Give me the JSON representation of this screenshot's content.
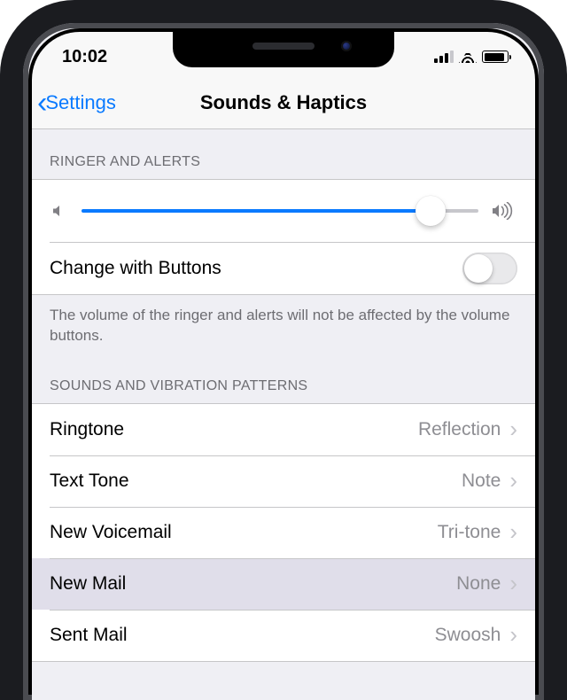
{
  "status": {
    "time": "10:02"
  },
  "nav": {
    "back": "Settings",
    "title": "Sounds & Haptics"
  },
  "ringer": {
    "header": "RINGER AND ALERTS",
    "slider_percent": 88,
    "change_label": "Change with Buttons",
    "change_on": false,
    "footer": "The volume of the ringer and alerts will not be affected by the volume buttons."
  },
  "patterns": {
    "header": "SOUNDS AND VIBRATION PATTERNS",
    "items": [
      {
        "label": "Ringtone",
        "value": "Reflection",
        "selected": false
      },
      {
        "label": "Text Tone",
        "value": "Note",
        "selected": false
      },
      {
        "label": "New Voicemail",
        "value": "Tri-tone",
        "selected": false
      },
      {
        "label": "New Mail",
        "value": "None",
        "selected": true
      },
      {
        "label": "Sent Mail",
        "value": "Swoosh",
        "selected": false
      }
    ]
  }
}
